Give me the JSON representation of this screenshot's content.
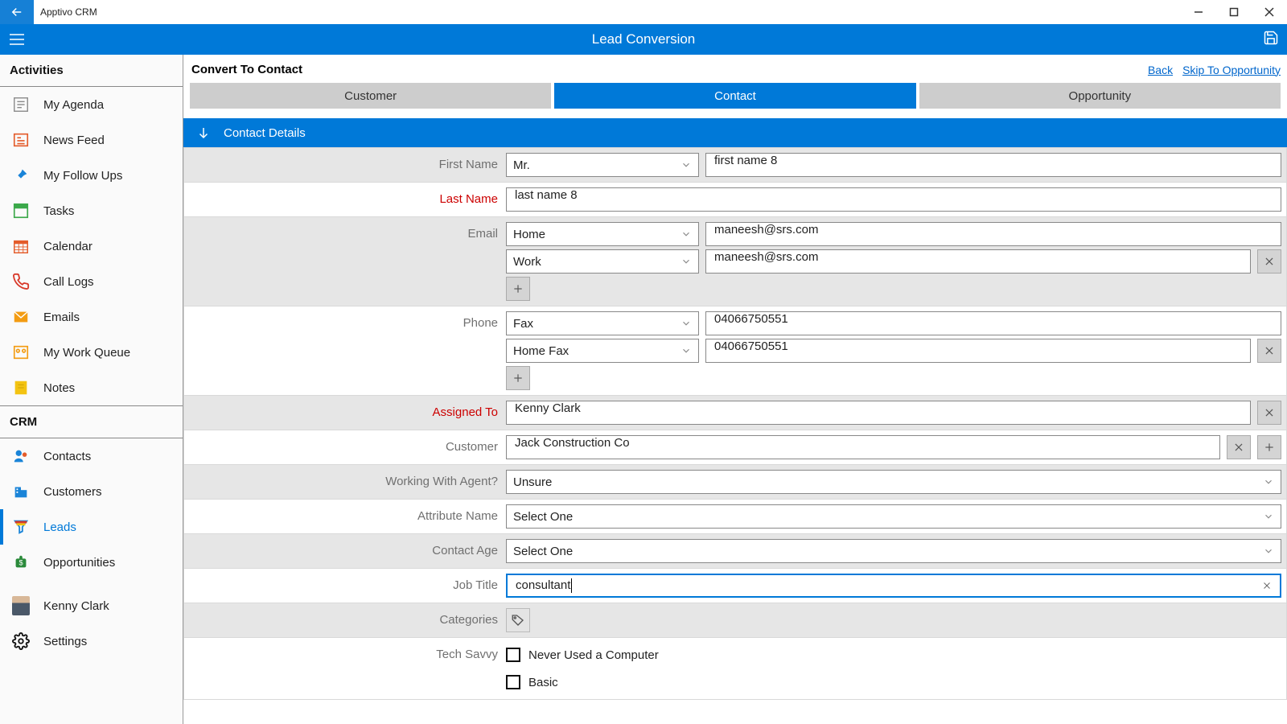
{
  "app": {
    "name": "Apptivo CRM"
  },
  "header": {
    "title": "Lead Conversion"
  },
  "sidebar": {
    "sections": [
      {
        "title": "Activities",
        "items": [
          {
            "id": "my-agenda",
            "label": "My Agenda"
          },
          {
            "id": "news-feed",
            "label": "News Feed"
          },
          {
            "id": "follow-ups",
            "label": "My Follow Ups"
          },
          {
            "id": "tasks",
            "label": "Tasks"
          },
          {
            "id": "calendar",
            "label": "Calendar"
          },
          {
            "id": "call-logs",
            "label": "Call Logs"
          },
          {
            "id": "emails",
            "label": "Emails"
          },
          {
            "id": "work-queue",
            "label": "My Work Queue"
          },
          {
            "id": "notes",
            "label": "Notes"
          }
        ]
      },
      {
        "title": "CRM",
        "items": [
          {
            "id": "contacts",
            "label": "Contacts"
          },
          {
            "id": "customers",
            "label": "Customers"
          },
          {
            "id": "leads",
            "label": "Leads",
            "active": true
          },
          {
            "id": "opportunities",
            "label": "Opportunities"
          }
        ]
      }
    ],
    "user": {
      "label": "Kenny Clark"
    },
    "settings": {
      "label": "Settings"
    }
  },
  "page": {
    "title": "Convert To Contact",
    "links": {
      "back": "Back",
      "skip": "Skip To Opportunity"
    },
    "tabs": {
      "customer": "Customer",
      "contact": "Contact",
      "opportunity": "Opportunity"
    },
    "section": "Contact Details"
  },
  "form": {
    "first_name": {
      "label": "First Name",
      "salutation": "Mr.",
      "value": "first name 8"
    },
    "last_name": {
      "label": "Last Name",
      "value": "last name 8"
    },
    "email": {
      "label": "Email",
      "rows": [
        {
          "type": "Home",
          "value": "maneesh@srs.com"
        },
        {
          "type": "Work",
          "value": "maneesh@srs.com"
        }
      ]
    },
    "phone": {
      "label": "Phone",
      "rows": [
        {
          "type": "Fax",
          "value": "04066750551"
        },
        {
          "type": "Home Fax",
          "value": "04066750551"
        }
      ]
    },
    "assigned_to": {
      "label": "Assigned To",
      "value": "Kenny Clark"
    },
    "customer": {
      "label": "Customer",
      "value": "Jack Construction Co"
    },
    "working_with_agent": {
      "label": "Working With Agent?",
      "value": "Unsure"
    },
    "attribute_name": {
      "label": "Attribute Name",
      "value": "Select One"
    },
    "contact_age": {
      "label": "Contact Age",
      "value": "Select One"
    },
    "job_title": {
      "label": "Job Title",
      "value": "consultant"
    },
    "categories": {
      "label": "Categories"
    },
    "tech_savvy": {
      "label": "Tech Savvy",
      "options": [
        {
          "label": "Never Used a Computer"
        },
        {
          "label": "Basic"
        }
      ]
    }
  }
}
